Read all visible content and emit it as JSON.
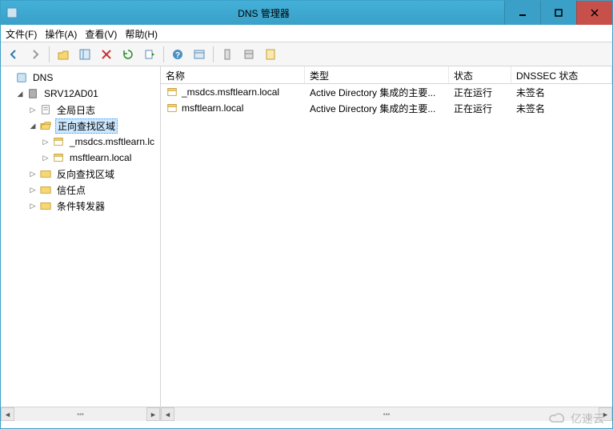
{
  "window": {
    "title": "DNS 管理器"
  },
  "menu": {
    "file": "文件(F)",
    "operate": "操作(A)",
    "view": "查看(V)",
    "help": "帮助(H)"
  },
  "tree": {
    "root": "DNS",
    "server": "SRV12AD01",
    "global_log": "全局日志",
    "forward_zone": "正向查找区域",
    "zone1": "_msdcs.msftlearn.lc",
    "zone2": "msftlearn.local",
    "reverse_zone": "反向查找区域",
    "trust_point": "信任点",
    "cond_forwarder": "条件转发器"
  },
  "columns": {
    "name": "名称",
    "type": "类型",
    "state": "状态",
    "dnssec": "DNSSEC 状态"
  },
  "rows": [
    {
      "name": "_msdcs.msftlearn.local",
      "type": "Active Directory 集成的主要...",
      "state": "正在运行",
      "dnssec": "未签名"
    },
    {
      "name": "msftlearn.local",
      "type": "Active Directory 集成的主要...",
      "state": "正在运行",
      "dnssec": "未签名"
    }
  ],
  "watermark": "亿速云"
}
